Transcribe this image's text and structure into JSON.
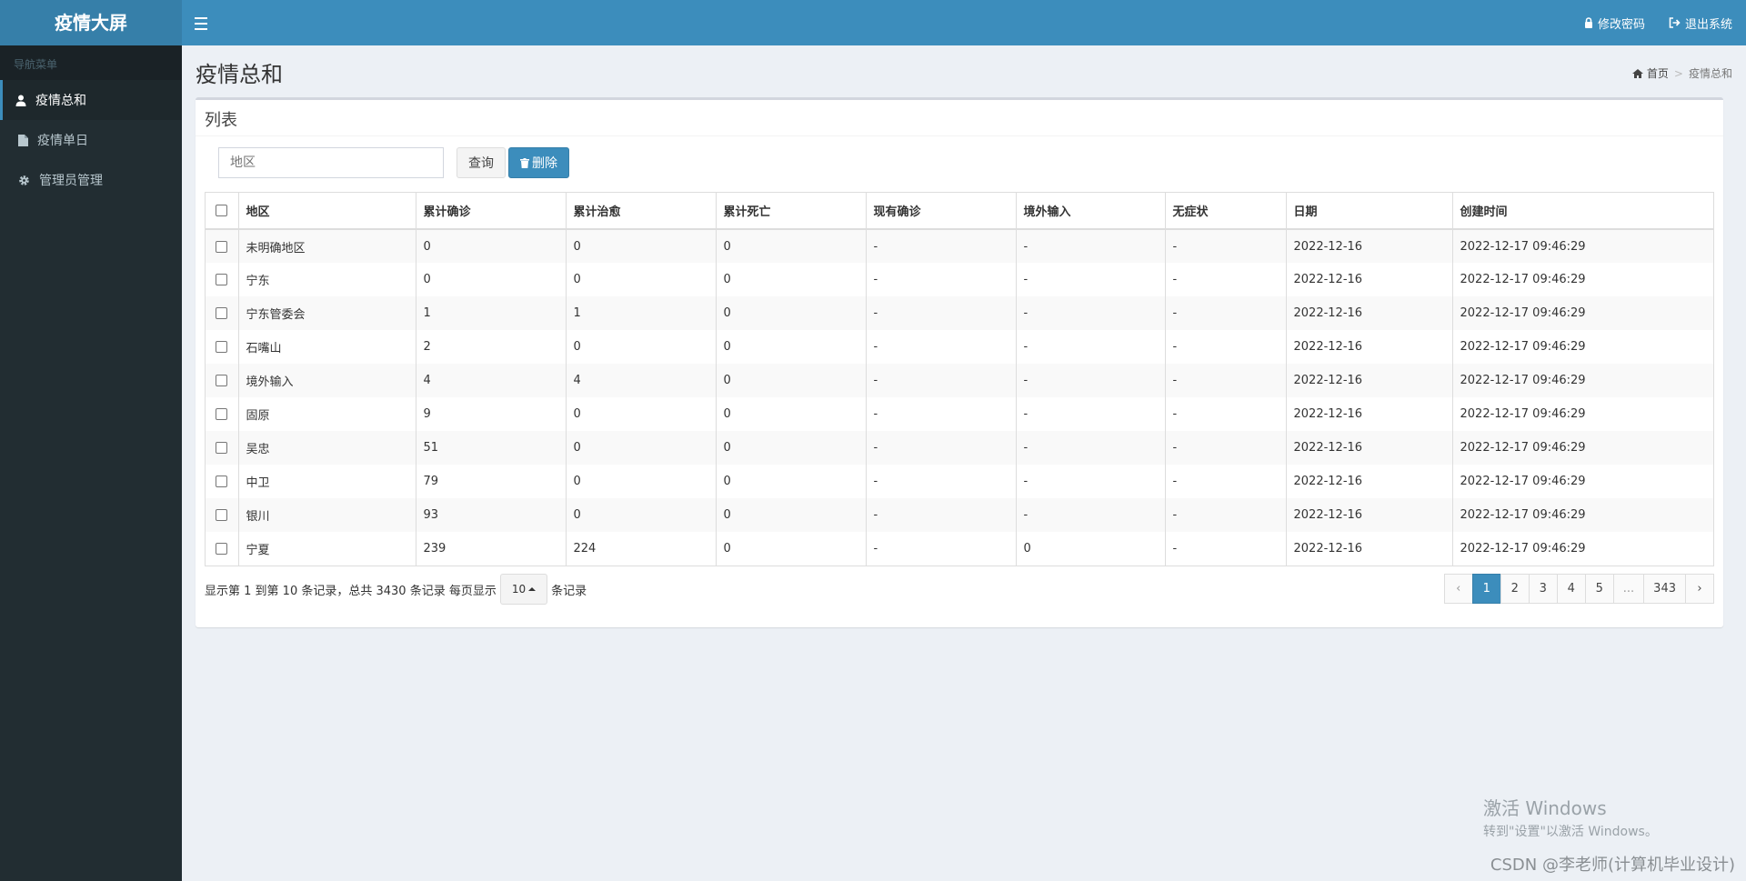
{
  "header": {
    "logo": "疫情大屏",
    "change_password": "修改密码",
    "logout": "退出系统"
  },
  "sidebar": {
    "title": "导航菜单",
    "items": [
      {
        "label": "疫情总和",
        "icon": "user-icon",
        "active": true
      },
      {
        "label": "疫情单日",
        "icon": "file-icon",
        "active": false
      },
      {
        "label": "管理员管理",
        "icon": "gear-icon",
        "active": false
      }
    ]
  },
  "page": {
    "title": "疫情总和",
    "breadcrumb_home": "首页",
    "breadcrumb_current": "疫情总和"
  },
  "box": {
    "title": "列表",
    "search_placeholder": "地区",
    "search_button": "查询",
    "delete_button": "删除"
  },
  "table": {
    "columns": [
      "地区",
      "累计确诊",
      "累计治愈",
      "累计死亡",
      "现有确诊",
      "境外输入",
      "无症状",
      "日期",
      "创建时间"
    ],
    "rows": [
      [
        "未明确地区",
        "0",
        "0",
        "0",
        "-",
        "-",
        "-",
        "2022-12-16",
        "2022-12-17 09:46:29"
      ],
      [
        "宁东",
        "0",
        "0",
        "0",
        "-",
        "-",
        "-",
        "2022-12-16",
        "2022-12-17 09:46:29"
      ],
      [
        "宁东管委会",
        "1",
        "1",
        "0",
        "-",
        "-",
        "-",
        "2022-12-16",
        "2022-12-17 09:46:29"
      ],
      [
        "石嘴山",
        "2",
        "0",
        "0",
        "-",
        "-",
        "-",
        "2022-12-16",
        "2022-12-17 09:46:29"
      ],
      [
        "境外输入",
        "4",
        "4",
        "0",
        "-",
        "-",
        "-",
        "2022-12-16",
        "2022-12-17 09:46:29"
      ],
      [
        "固原",
        "9",
        "0",
        "0",
        "-",
        "-",
        "-",
        "2022-12-16",
        "2022-12-17 09:46:29"
      ],
      [
        "吴忠",
        "51",
        "0",
        "0",
        "-",
        "-",
        "-",
        "2022-12-16",
        "2022-12-17 09:46:29"
      ],
      [
        "中卫",
        "79",
        "0",
        "0",
        "-",
        "-",
        "-",
        "2022-12-16",
        "2022-12-17 09:46:29"
      ],
      [
        "银川",
        "93",
        "0",
        "0",
        "-",
        "-",
        "-",
        "2022-12-16",
        "2022-12-17 09:46:29"
      ],
      [
        "宁夏",
        "239",
        "224",
        "0",
        "-",
        "0",
        "-",
        "2022-12-16",
        "2022-12-17 09:46:29"
      ]
    ]
  },
  "pagination": {
    "info_prefix": "显示第 1 到第 10 条记录，总共 3430 条记录 每页显示",
    "page_size": "10",
    "info_suffix": "条记录",
    "prev": "‹",
    "pages": [
      "1",
      "2",
      "3",
      "4",
      "5",
      "...",
      "343"
    ],
    "next": "›",
    "active_page": "1"
  },
  "watermark": {
    "windows_line1": "激活 Windows",
    "windows_line2": "转到\"设置\"以激活 Windows。",
    "csdn": "CSDN @李老师(计算机毕业设计)"
  },
  "colors": {
    "header": "#3c8dbc",
    "logo_bg": "#367fa9",
    "sidebar_bg": "#222d32",
    "content_bg": "#ecf0f5",
    "primary": "#3c8dbc"
  }
}
